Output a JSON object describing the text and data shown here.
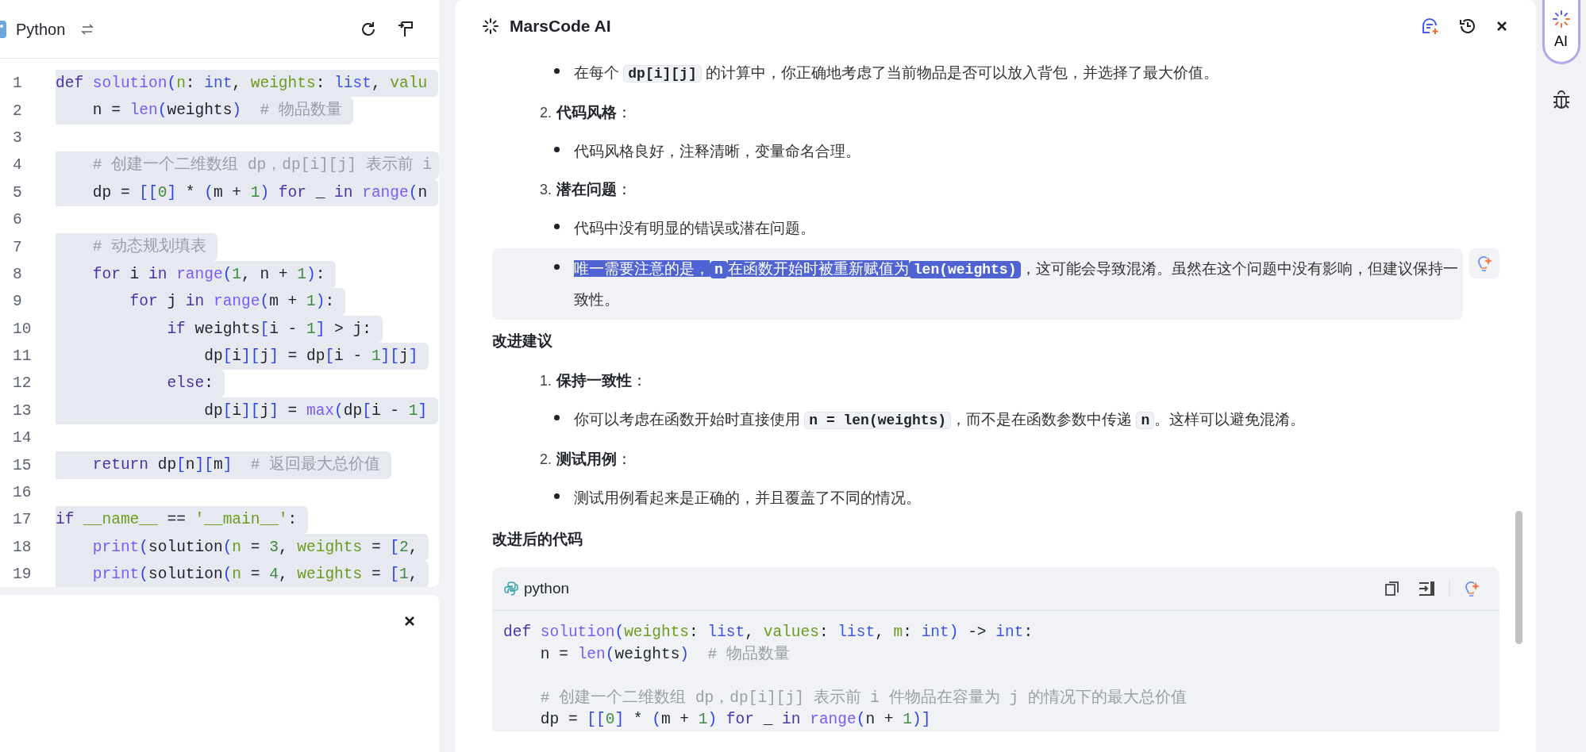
{
  "editor": {
    "language": "Python",
    "lines": [
      {
        "number": "1",
        "selected": true,
        "tokens": [
          {
            "kind": "kw",
            "text": "def"
          },
          {
            "kind": "fn",
            "text": " solution"
          },
          {
            "kind": "br",
            "text": "("
          },
          {
            "kind": "pa",
            "text": "n"
          },
          {
            "kind": "p",
            "text": ": "
          },
          {
            "kind": "ty",
            "text": "int"
          },
          {
            "kind": "p",
            "text": ", "
          },
          {
            "kind": "pa",
            "text": "weights"
          },
          {
            "kind": "p",
            "text": ": "
          },
          {
            "kind": "ty",
            "text": "list"
          },
          {
            "kind": "p",
            "text": ", "
          },
          {
            "kind": "pa",
            "text": "valu"
          }
        ]
      },
      {
        "number": "2",
        "selected": true,
        "tokens": [
          {
            "kind": "p",
            "text": "    n = "
          },
          {
            "kind": "fn",
            "text": "len"
          },
          {
            "kind": "br",
            "text": "("
          },
          {
            "kind": "p",
            "text": "weights"
          },
          {
            "kind": "br",
            "text": ")"
          },
          {
            "kind": "cm",
            "text": "  # 物品数量"
          }
        ]
      },
      {
        "number": "3",
        "selected": false
      },
      {
        "number": "4",
        "selected": true,
        "tokens": [
          {
            "kind": "cm",
            "text": "    # 创建一个二维数组 dp，dp[i][j] 表示前 i"
          }
        ]
      },
      {
        "number": "5",
        "selected": true,
        "tokens": [
          {
            "kind": "p",
            "text": "    dp = "
          },
          {
            "kind": "br",
            "text": "[["
          },
          {
            "kind": "nu",
            "text": "0"
          },
          {
            "kind": "br",
            "text": "]"
          },
          {
            "kind": "p",
            "text": " * "
          },
          {
            "kind": "br",
            "text": "("
          },
          {
            "kind": "p",
            "text": "m + "
          },
          {
            "kind": "nu",
            "text": "1"
          },
          {
            "kind": "br",
            "text": ")"
          },
          {
            "kind": "kw",
            "text": " for"
          },
          {
            "kind": "p",
            "text": " _ "
          },
          {
            "kind": "kw",
            "text": "in"
          },
          {
            "kind": "fn",
            "text": " range"
          },
          {
            "kind": "br",
            "text": "("
          },
          {
            "kind": "p",
            "text": "n"
          }
        ]
      },
      {
        "number": "6",
        "selected": false
      },
      {
        "number": "7",
        "selected": true,
        "tokens": [
          {
            "kind": "cm",
            "text": "    # 动态规划填表"
          }
        ]
      },
      {
        "number": "8",
        "selected": true,
        "tokens": [
          {
            "kind": "kw",
            "text": "    for"
          },
          {
            "kind": "p",
            "text": " i "
          },
          {
            "kind": "kw",
            "text": "in"
          },
          {
            "kind": "fn",
            "text": " range"
          },
          {
            "kind": "br",
            "text": "("
          },
          {
            "kind": "nu",
            "text": "1"
          },
          {
            "kind": "p",
            "text": ", n + "
          },
          {
            "kind": "nu",
            "text": "1"
          },
          {
            "kind": "br",
            "text": ")"
          },
          {
            "kind": "p",
            "text": ":"
          }
        ]
      },
      {
        "number": "9",
        "selected": true,
        "tokens": [
          {
            "kind": "kw",
            "text": "        for"
          },
          {
            "kind": "p",
            "text": " j "
          },
          {
            "kind": "kw",
            "text": "in"
          },
          {
            "kind": "fn",
            "text": " range"
          },
          {
            "kind": "br",
            "text": "("
          },
          {
            "kind": "p",
            "text": "m + "
          },
          {
            "kind": "nu",
            "text": "1"
          },
          {
            "kind": "br",
            "text": ")"
          },
          {
            "kind": "p",
            "text": ":"
          }
        ]
      },
      {
        "number": "10",
        "selected": true,
        "tokens": [
          {
            "kind": "kw",
            "text": "            if"
          },
          {
            "kind": "p",
            "text": " weights"
          },
          {
            "kind": "br",
            "text": "["
          },
          {
            "kind": "p",
            "text": "i - "
          },
          {
            "kind": "nu",
            "text": "1"
          },
          {
            "kind": "br",
            "text": "]"
          },
          {
            "kind": "p",
            "text": " > j:"
          }
        ]
      },
      {
        "number": "11",
        "selected": true,
        "tokens": [
          {
            "kind": "p",
            "text": "                dp"
          },
          {
            "kind": "br",
            "text": "["
          },
          {
            "kind": "p",
            "text": "i"
          },
          {
            "kind": "br",
            "text": "]["
          },
          {
            "kind": "p",
            "text": "j"
          },
          {
            "kind": "br",
            "text": "]"
          },
          {
            "kind": "p",
            "text": " = dp"
          },
          {
            "kind": "br",
            "text": "["
          },
          {
            "kind": "p",
            "text": "i - "
          },
          {
            "kind": "nu",
            "text": "1"
          },
          {
            "kind": "br",
            "text": "]["
          },
          {
            "kind": "p",
            "text": "j"
          },
          {
            "kind": "br",
            "text": "]"
          }
        ]
      },
      {
        "number": "12",
        "selected": true,
        "tokens": [
          {
            "kind": "kw",
            "text": "            else"
          },
          {
            "kind": "p",
            "text": ":"
          }
        ]
      },
      {
        "number": "13",
        "selected": true,
        "tokens": [
          {
            "kind": "p",
            "text": "                dp"
          },
          {
            "kind": "br",
            "text": "["
          },
          {
            "kind": "p",
            "text": "i"
          },
          {
            "kind": "br",
            "text": "]["
          },
          {
            "kind": "p",
            "text": "j"
          },
          {
            "kind": "br",
            "text": "]"
          },
          {
            "kind": "p",
            "text": " = "
          },
          {
            "kind": "fn",
            "text": "max"
          },
          {
            "kind": "br",
            "text": "("
          },
          {
            "kind": "p",
            "text": "dp"
          },
          {
            "kind": "br",
            "text": "["
          },
          {
            "kind": "p",
            "text": "i - "
          },
          {
            "kind": "nu",
            "text": "1"
          },
          {
            "kind": "br",
            "text": "]"
          }
        ]
      },
      {
        "number": "14",
        "selected": false
      },
      {
        "number": "15",
        "selected": true,
        "tokens": [
          {
            "kind": "kw",
            "text": "    return"
          },
          {
            "kind": "p",
            "text": " dp"
          },
          {
            "kind": "br",
            "text": "["
          },
          {
            "kind": "p",
            "text": "n"
          },
          {
            "kind": "br",
            "text": "]["
          },
          {
            "kind": "p",
            "text": "m"
          },
          {
            "kind": "br",
            "text": "]"
          },
          {
            "kind": "cm",
            "text": "  # 返回最大总价值"
          }
        ]
      },
      {
        "number": "16",
        "selected": false
      },
      {
        "number": "17",
        "selected": true,
        "tokens": [
          {
            "kind": "kw",
            "text": "if"
          },
          {
            "kind": "pa",
            "text": " __name__"
          },
          {
            "kind": "p",
            "text": " == "
          },
          {
            "kind": "st",
            "text": "'__main__'"
          },
          {
            "kind": "p",
            "text": ":"
          }
        ]
      },
      {
        "number": "18",
        "selected": true,
        "tokens": [
          {
            "kind": "fn",
            "text": "    print"
          },
          {
            "kind": "br",
            "text": "("
          },
          {
            "kind": "p",
            "text": "solution"
          },
          {
            "kind": "br",
            "text": "("
          },
          {
            "kind": "pa",
            "text": "n"
          },
          {
            "kind": "p",
            "text": " = "
          },
          {
            "kind": "nu",
            "text": "3"
          },
          {
            "kind": "p",
            "text": ", "
          },
          {
            "kind": "pa",
            "text": "weights"
          },
          {
            "kind": "p",
            "text": " = "
          },
          {
            "kind": "br",
            "text": "["
          },
          {
            "kind": "nu",
            "text": "2"
          },
          {
            "kind": "p",
            "text": ","
          }
        ]
      },
      {
        "number": "19",
        "selected": true,
        "tokens": [
          {
            "kind": "fn",
            "text": "    print"
          },
          {
            "kind": "br",
            "text": "("
          },
          {
            "kind": "p",
            "text": "solution"
          },
          {
            "kind": "br",
            "text": "("
          },
          {
            "kind": "pa",
            "text": "n"
          },
          {
            "kind": "p",
            "text": " = "
          },
          {
            "kind": "nu",
            "text": "4"
          },
          {
            "kind": "p",
            "text": ", "
          },
          {
            "kind": "pa",
            "text": "weights"
          },
          {
            "kind": "p",
            "text": " = "
          },
          {
            "kind": "br",
            "text": "["
          },
          {
            "kind": "nu",
            "text": "1"
          },
          {
            "kind": "p",
            "text": ","
          }
        ]
      }
    ]
  },
  "ai_panel": {
    "title": "MarsCode AI",
    "sections": [
      {
        "items": [
          {
            "children": [
              {
                "hovered": false,
                "segments": [
                  {
                    "kind": "text",
                    "selected": false,
                    "text": "在每个 "
                  },
                  {
                    "kind": "code",
                    "selected": false,
                    "text": "dp[i][j]"
                  },
                  {
                    "kind": "text",
                    "selected": false,
                    "text": " 的计算中，你正确地考虑了当前物品是否可以放入背包，并选择了最大价值。"
                  }
                ]
              }
            ]
          },
          {
            "number": "2.",
            "label": "**代码风格**：",
            "children": [
              {
                "hovered": false,
                "segments": [
                  {
                    "kind": "text",
                    "selected": false,
                    "text": "代码风格良好，注释清晰，变量命名合理。"
                  }
                ]
              }
            ]
          },
          {
            "number": "3.",
            "label": "**潜在问题**：",
            "children": [
              {
                "hovered": false,
                "segments": [
                  {
                    "kind": "text",
                    "selected": false,
                    "text": "代码中没有明显的错误或潜在问题。"
                  }
                ]
              },
              {
                "hovered": true,
                "segments": [
                  {
                    "kind": "text",
                    "selected": true,
                    "text": "唯一需要注意的是，"
                  },
                  {
                    "kind": "code",
                    "selected": true,
                    "text": "n"
                  },
                  {
                    "kind": "text",
                    "selected": true,
                    "text": "在函数开始时被重新赋值为"
                  },
                  {
                    "kind": "code",
                    "selected": true,
                    "text": "len(weights)"
                  },
                  {
                    "kind": "text",
                    "selected": false,
                    "text": "，这可能会导致混淆。虽然在这个问题中没有影响，但建议保持一致性。"
                  }
                ]
              }
            ]
          }
        ]
      },
      {
        "heading": "改进建议",
        "items": [
          {
            "number": "1.",
            "label": "**保持一致性**：",
            "children": [
              {
                "hovered": false,
                "segments": [
                  {
                    "kind": "text",
                    "selected": false,
                    "text": "你可以考虑在函数开始时直接使用 "
                  },
                  {
                    "kind": "code",
                    "selected": false,
                    "text": "n = len(weights)"
                  },
                  {
                    "kind": "text",
                    "selected": false,
                    "text": "，而不是在函数参数中传递 "
                  },
                  {
                    "kind": "code",
                    "selected": false,
                    "text": "n"
                  },
                  {
                    "kind": "text",
                    "selected": false,
                    "text": "。这样可以避免混淆。"
                  }
                ]
              }
            ]
          },
          {
            "number": "2.",
            "label": "**测试用例**：",
            "children": [
              {
                "hovered": false,
                "segments": [
                  {
                    "kind": "text",
                    "selected": false,
                    "text": "测试用例看起来是正确的，并且覆盖了不同的情况。"
                  }
                ]
              }
            ]
          }
        ]
      },
      {
        "heading": "改进后的代码",
        "code_block": {
          "language": "python",
          "lines": [
            {
              "tokens": [
                {
                  "kind": "kw",
                  "text": "def"
                },
                {
                  "kind": "fn",
                  "text": " solution"
                },
                {
                  "kind": "br",
                  "text": "("
                },
                {
                  "kind": "pa",
                  "text": "weights"
                },
                {
                  "kind": "p",
                  "text": ": "
                },
                {
                  "kind": "ty",
                  "text": "list"
                },
                {
                  "kind": "p",
                  "text": ", "
                },
                {
                  "kind": "pa",
                  "text": "values"
                },
                {
                  "kind": "p",
                  "text": ": "
                },
                {
                  "kind": "ty",
                  "text": "list"
                },
                {
                  "kind": "p",
                  "text": ", "
                },
                {
                  "kind": "pa",
                  "text": "m"
                },
                {
                  "kind": "p",
                  "text": ": "
                },
                {
                  "kind": "ty",
                  "text": "int"
                },
                {
                  "kind": "br",
                  "text": ")"
                },
                {
                  "kind": "p",
                  "text": " -> "
                },
                {
                  "kind": "ty",
                  "text": "int"
                },
                {
                  "kind": "p",
                  "text": ":"
                }
              ]
            },
            {
              "tokens": [
                {
                  "kind": "p",
                  "text": "    n = "
                },
                {
                  "kind": "fn",
                  "text": "len"
                },
                {
                  "kind": "br",
                  "text": "("
                },
                {
                  "kind": "p",
                  "text": "weights"
                },
                {
                  "kind": "br",
                  "text": ")"
                },
                {
                  "kind": "cm",
                  "text": "  # 物品数量"
                }
              ]
            },
            {
              "blank": true
            },
            {
              "tokens": [
                {
                  "kind": "cm",
                  "text": "    # 创建一个二维数组 dp，dp[i][j] 表示前 i 件物品在容量为 j 的情况下的最大总价值"
                }
              ]
            },
            {
              "tokens": [
                {
                  "kind": "p",
                  "text": "    dp = "
                },
                {
                  "kind": "br",
                  "text": "[["
                },
                {
                  "kind": "nu",
                  "text": "0"
                },
                {
                  "kind": "br",
                  "text": "]"
                },
                {
                  "kind": "p",
                  "text": " * "
                },
                {
                  "kind": "br",
                  "text": "("
                },
                {
                  "kind": "p",
                  "text": "m + "
                },
                {
                  "kind": "nu",
                  "text": "1"
                },
                {
                  "kind": "br",
                  "text": ")"
                },
                {
                  "kind": "kw",
                  "text": " for"
                },
                {
                  "kind": "p",
                  "text": " _ "
                },
                {
                  "kind": "kw",
                  "text": "in"
                },
                {
                  "kind": "fn",
                  "text": " range"
                },
                {
                  "kind": "br",
                  "text": "("
                },
                {
                  "kind": "p",
                  "text": "n + "
                },
                {
                  "kind": "nu",
                  "text": "1"
                },
                {
                  "kind": "br",
                  "text": ")]"
                }
              ]
            }
          ]
        }
      }
    ]
  },
  "sidebar": {
    "items": [
      {
        "kind": "ai",
        "label": "AI",
        "selected": true
      },
      {
        "kind": "debug",
        "selected": false
      }
    ]
  }
}
